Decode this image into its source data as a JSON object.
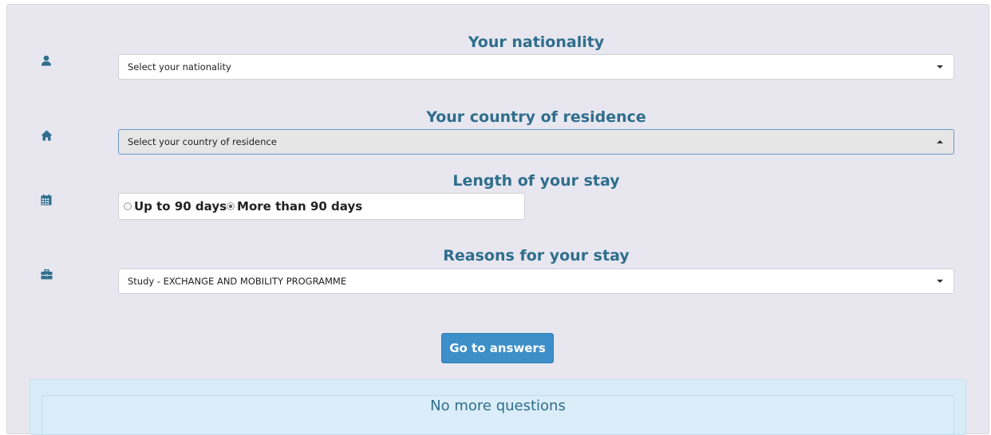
{
  "form": {
    "nationality": {
      "title": "Your nationality",
      "icon": "user-icon",
      "placeholder": "Select your nationality"
    },
    "residence": {
      "title": "Your country of residence",
      "icon": "home-icon",
      "placeholder": "Select your country of residence",
      "open": true
    },
    "stay_length": {
      "title": "Length of your stay",
      "icon": "calendar-icon",
      "options": [
        {
          "label": "Up to 90 days",
          "checked": false
        },
        {
          "label": "More than 90 days",
          "checked": true
        }
      ]
    },
    "reasons": {
      "title": "Reasons for your stay",
      "icon": "briefcase-icon",
      "value": "Study - EXCHANGE AND MOBILITY PROGRAMME"
    },
    "submit_label": "Go to answers"
  },
  "info": {
    "message": "No more questions"
  },
  "colors": {
    "panel_bg": "#e8e7f0",
    "title": "#2f6e8c",
    "button": "#3c8fc8",
    "info_bg": "#d8ecf7"
  }
}
